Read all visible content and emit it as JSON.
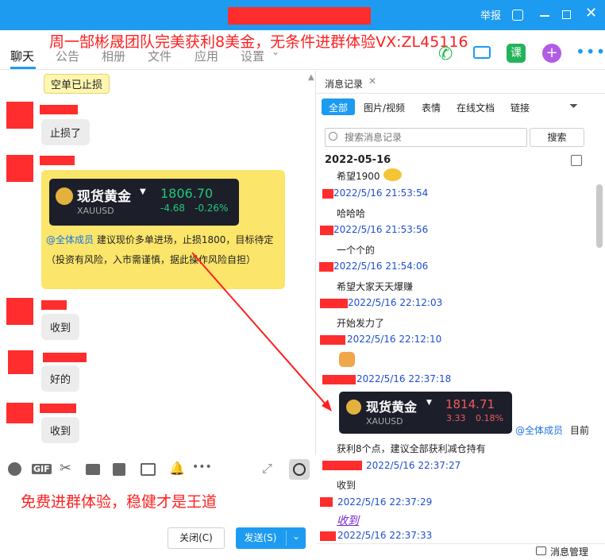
{
  "window": {
    "report": "举报"
  },
  "tabs": [
    {
      "label": "聊天"
    },
    {
      "label": "公告"
    },
    {
      "label": "相册"
    },
    {
      "label": "文件"
    },
    {
      "label": "应用"
    },
    {
      "label": "设置"
    }
  ],
  "overlay_top": "周一郜彬晟团队完美获利8美金，无条件进群体验VX:ZL45116",
  "overlay_bottom": "免费进群体验，稳健才是王道",
  "chat": {
    "notice": "空单已止损",
    "msg1": "止损了",
    "card": {
      "name": "现货黄金",
      "symbol": "XAUUSD",
      "price": "1806.70",
      "change": "-4.68",
      "pct": "-0.26%",
      "mention": "@全体成员",
      "text": "建议现价多单进场，止损1800，目标待定（投资有风险，入市需谨慎，据此操作风险自担）"
    },
    "msg2": "收到",
    "msg3": "好的",
    "msg4": "收到"
  },
  "buttons": {
    "close": "关闭(C)",
    "send": "发送(S)"
  },
  "history": {
    "tab": "消息记录",
    "filters": [
      "全部",
      "图片/视频",
      "表情",
      "在线文档",
      "链接"
    ],
    "search_placeholder": "搜索消息记录",
    "search_btn": "搜索",
    "date": "2022-05-16",
    "entries": [
      {
        "text": "希望1900",
        "time": "2022/5/16 21:53:54"
      },
      {
        "text": "哈哈哈",
        "time": "2022/5/16 21:53:56"
      },
      {
        "text": "一个个的",
        "time": "2022/5/16 21:54:06"
      },
      {
        "text": "希望大家天天爆赚",
        "time": "2022/5/16 22:12:03"
      },
      {
        "text": "开始发力了",
        "time": "2022/5/16 22:12:10"
      },
      {
        "text": "",
        "time": "2022/5/16 22:37:18"
      },
      {
        "text": "获利8个点，建议全部获利减仓持有",
        "time": "2022/5/16 22:37:27"
      },
      {
        "text": "收到",
        "time": "2022/5/16 22:37:29"
      },
      {
        "text": "收到",
        "time": "2022/5/16 22:37:33"
      }
    ],
    "card2": {
      "name": "现货黄金",
      "symbol": "XAUUSD",
      "price": "1814.71",
      "change": "3.33",
      "pct": "0.18%",
      "mention": "@全体成员",
      "after": "目前"
    },
    "manage": "消息管理"
  },
  "colors": {
    "accent": "#1d9bf0",
    "redact": "#ff2d2d",
    "overlay": "#ff2020",
    "card_yellow": "#fbe56a"
  }
}
